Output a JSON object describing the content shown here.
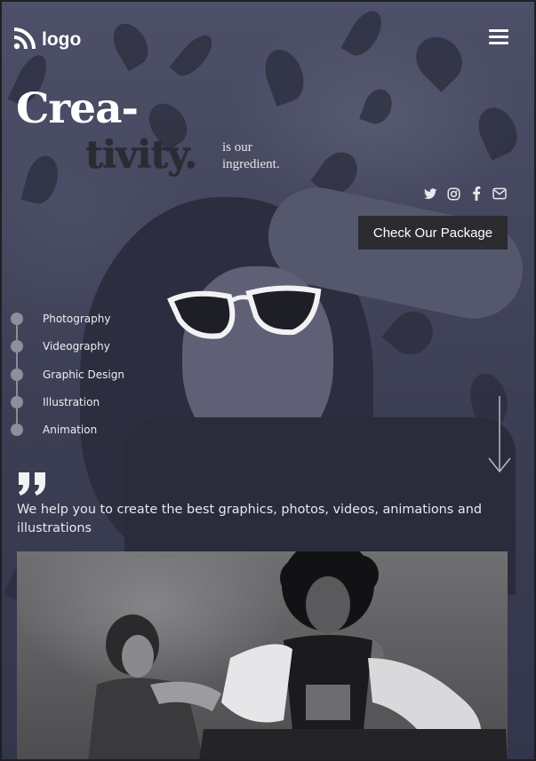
{
  "brand": {
    "logo_text": "logo"
  },
  "hero": {
    "headline_line1": "Crea-",
    "headline_line2": "tivity.",
    "sub_line1": "is our",
    "sub_line2": "ingredient."
  },
  "social": {
    "icons": [
      "twitter-icon",
      "instagram-icon",
      "facebook-icon",
      "mail-icon"
    ]
  },
  "cta": {
    "label": "Check Our Package"
  },
  "services": [
    {
      "label": "Photography"
    },
    {
      "label": "Videography"
    },
    {
      "label": "Graphic Design"
    },
    {
      "label": "Illustration"
    },
    {
      "label": "Animation"
    }
  ],
  "quote": {
    "text": "We help you to create the best graphics, photos, videos, animations and illustrations"
  },
  "colors": {
    "hero_overlay": "#3b3d52",
    "button_bg": "#2b2b30",
    "text_light": "#ffffff"
  }
}
